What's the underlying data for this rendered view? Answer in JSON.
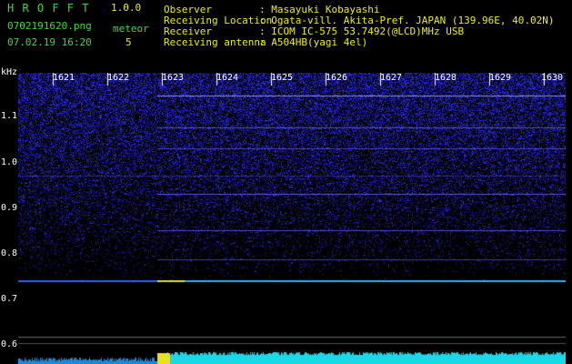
{
  "header": {
    "brand": "H R O F F T",
    "version": "1.0.0",
    "filename": "0702191620.png",
    "meteor_label": "meteor",
    "timestamp": "07.02.19 16:20",
    "meteor_count": "5"
  },
  "info": [
    {
      "key": "Observer",
      "value": ": Masayuki Kobayashi"
    },
    {
      "key": "Receiving Location",
      "value": ": Ogata-vill. Akita-Pref. JAPAN (139.96E, 40.02N)"
    },
    {
      "key": "Receiver",
      "value": ": ICOM IC-575 53.7492(@LCD)MHz USB"
    },
    {
      "key": "Receiving antenna",
      "value": ": A504HB(yagi 4el)"
    }
  ],
  "axis": {
    "y_unit": "kHz",
    "y_ticks": [
      "1.1",
      "1.0",
      "0.9",
      "0.8",
      "0.7",
      "0.6"
    ],
    "x_ticks": [
      "1621",
      "1622",
      "1623",
      "1624",
      "1625",
      "1626",
      "1627",
      "1628",
      "1629",
      "1630"
    ]
  },
  "colors": {
    "title_green": "#3ddc3d",
    "title_yellow": "#f0f000",
    "background": "#000000",
    "noise": "#2a2ad8",
    "echo_cyan": "#19d9e6",
    "echo_yellow": "#e8e020"
  },
  "chart_data": {
    "type": "heatmap",
    "title": "",
    "xlabel": "",
    "ylabel": "kHz",
    "x_ticks": [
      1621,
      1622,
      1623,
      1624,
      1625,
      1626,
      1627,
      1628,
      1629,
      1630
    ],
    "y_ticks": [
      1.1,
      1.0,
      0.9,
      0.8,
      0.7,
      0.6
    ]
  }
}
